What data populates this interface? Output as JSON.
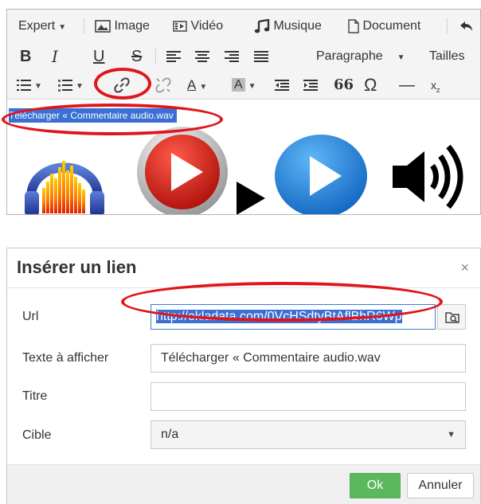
{
  "toolbar": {
    "row1": {
      "expert_label": "Expert",
      "image_label": "Image",
      "video_label": "Vidéo",
      "music_label": "Musique",
      "document_label": "Document"
    },
    "row2": {
      "bold_glyph": "B",
      "italic_glyph": "I",
      "underline_glyph": "U",
      "strike_glyph": "S",
      "format_label": "Paragraphe",
      "size_label": "Tailles"
    },
    "row3": {
      "quote_glyph": "66",
      "omega_glyph": "Ω",
      "hr_glyph": "—"
    }
  },
  "content": {
    "selected_text": "Télécharger « Commentaire audio.wav",
    "icons": [
      "audacity-icon",
      "red-play-icon",
      "black-triangle-icon",
      "blue-play-icon",
      "speaker-icon"
    ]
  },
  "dialog": {
    "title": "Insérer un lien",
    "close_glyph": "×",
    "fields": {
      "url_label": "Url",
      "url_value": "http://ekladata.com/0VcHSdtyBtAflBhR6Wp",
      "text_label": "Texte à afficher",
      "text_value": "Télécharger « Commentaire audio.wav",
      "title_label": "Titre",
      "title_value": "",
      "target_label": "Cible",
      "target_value": "n/a"
    },
    "buttons": {
      "ok": "Ok",
      "cancel": "Annuler"
    }
  },
  "colors": {
    "highlight": "#e0151c",
    "selection": "#3a70d4",
    "ok_button": "#5cb85c"
  }
}
